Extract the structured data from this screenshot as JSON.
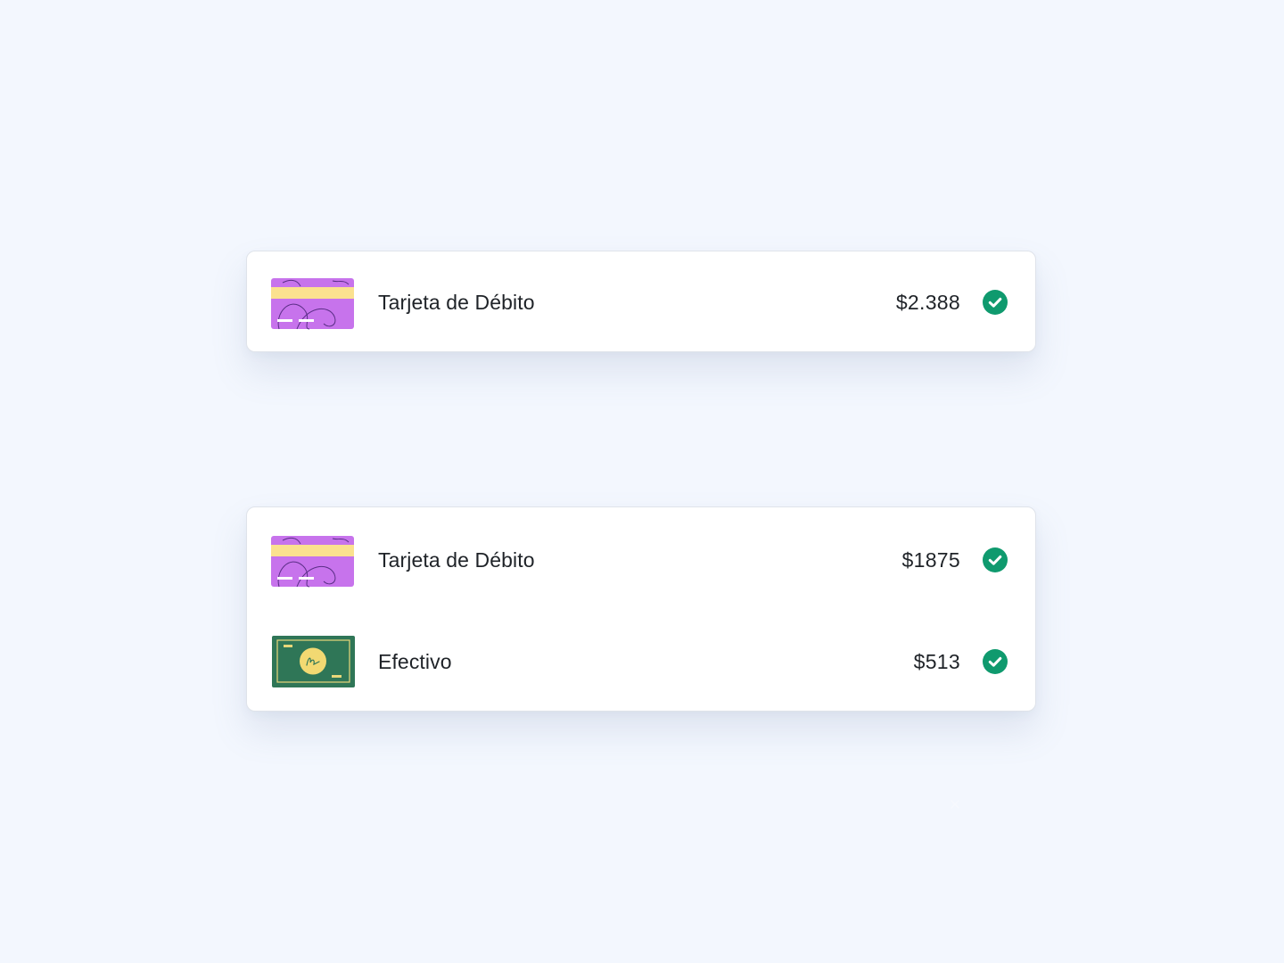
{
  "summary_card": {
    "row": {
      "method_icon": "debit-card-icon",
      "label": "Tarjeta de Débito",
      "amount": "$2.388",
      "status_icon": "check-circle-icon"
    }
  },
  "split_card": {
    "rows": [
      {
        "method_icon": "debit-card-icon",
        "label": "Tarjeta de Débito",
        "amount": "$1875",
        "status_icon": "check-circle-icon"
      },
      {
        "method_icon": "cash-bill-icon",
        "label": "Efectivo",
        "amount": "$513",
        "status_icon": "check-circle-icon"
      }
    ]
  },
  "colors": {
    "background": "#f3f7fe",
    "card": "#ffffff",
    "success": "#0f9a6e",
    "card_purple": "#c773ec",
    "card_stripe": "#fbe18f",
    "cash_green": "#2f7657",
    "cash_coin": "#f2d972"
  }
}
